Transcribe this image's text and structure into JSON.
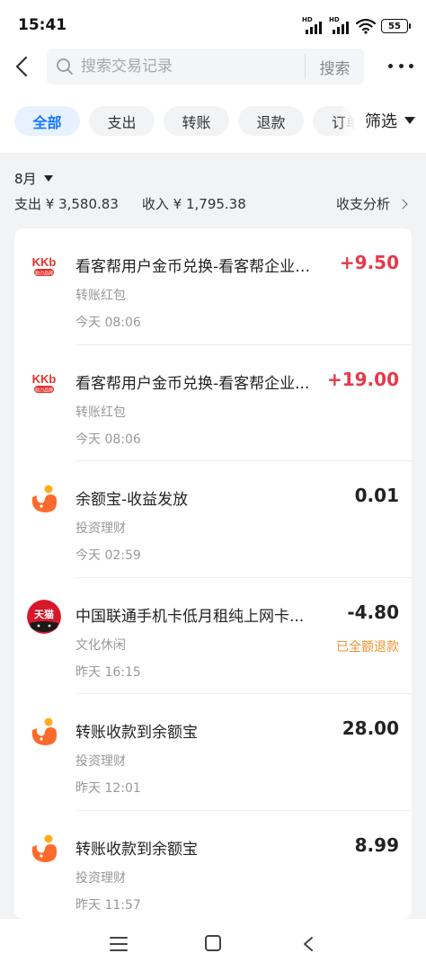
{
  "status_bar": {
    "time": "15:41",
    "battery": "55",
    "signal_label": "HD",
    "icons": [
      "signal-hd-icon",
      "signal-hd-icon",
      "wifi-icon",
      "battery-icon"
    ]
  },
  "search": {
    "back_icon": "back-arrow-icon",
    "search_icon": "search-icon",
    "placeholder": "搜索交易记录",
    "button_label": "搜索",
    "more_icon": "more-dots-icon"
  },
  "filters": {
    "tabs": [
      {
        "label": "全部",
        "active": true
      },
      {
        "label": "支出",
        "active": false
      },
      {
        "label": "转账",
        "active": false
      },
      {
        "label": "退款",
        "active": false
      },
      {
        "label": "订单",
        "active": false
      }
    ],
    "filter_label": "筛选"
  },
  "summary": {
    "month": "8月",
    "expense": "支出 ¥ 3,580.83",
    "income": "收入 ¥ 1,795.38",
    "analysis_label": "收支分析"
  },
  "transactions": [
    {
      "icon": "kkb-logo-icon",
      "title": "看客帮用户金币兑换-看客帮企业账户",
      "category": "转账红包",
      "time": "今天 08:06",
      "amount": "+9.50",
      "type": "income",
      "note": ""
    },
    {
      "icon": "kkb-logo-icon",
      "title": "看客帮用户金币兑换-看客帮企业...",
      "category": "转账红包",
      "time": "今天 08:06",
      "amount": "+19.00",
      "type": "income",
      "note": ""
    },
    {
      "icon": "yuebao-icon",
      "title": "余额宝-收益发放",
      "category": "投资理财",
      "time": "今天 02:59",
      "amount": "0.01",
      "type": "neutral",
      "note": ""
    },
    {
      "icon": "tmall-icon",
      "title": "中国联通手机卡低月租纯上网卡...",
      "category": "文化休闲",
      "time": "昨天 16:15",
      "amount": "-4.80",
      "type": "expense",
      "note": "已全额退款"
    },
    {
      "icon": "yuebao-icon",
      "title": "转账收款到余额宝",
      "category": "投资理财",
      "time": "昨天 12:01",
      "amount": "28.00",
      "type": "neutral",
      "note": ""
    },
    {
      "icon": "yuebao-icon",
      "title": "转账收款到余额宝",
      "category": "投资理财",
      "time": "昨天 11:57",
      "amount": "8.99",
      "type": "neutral",
      "note": ""
    }
  ],
  "icon_text": {
    "kkb_logo": "KKb",
    "kkb_sub": "助力品牌",
    "tmall_logo": "天猫"
  },
  "colors": {
    "accent": "#1677ff",
    "income": "#e6394a",
    "refund_note": "#f0912b",
    "yuebao_orange": "#fd6b2c",
    "tmall_red": "#d7172a"
  },
  "nav": {
    "icons": [
      "menu-icon",
      "home-icon",
      "back-icon"
    ]
  }
}
